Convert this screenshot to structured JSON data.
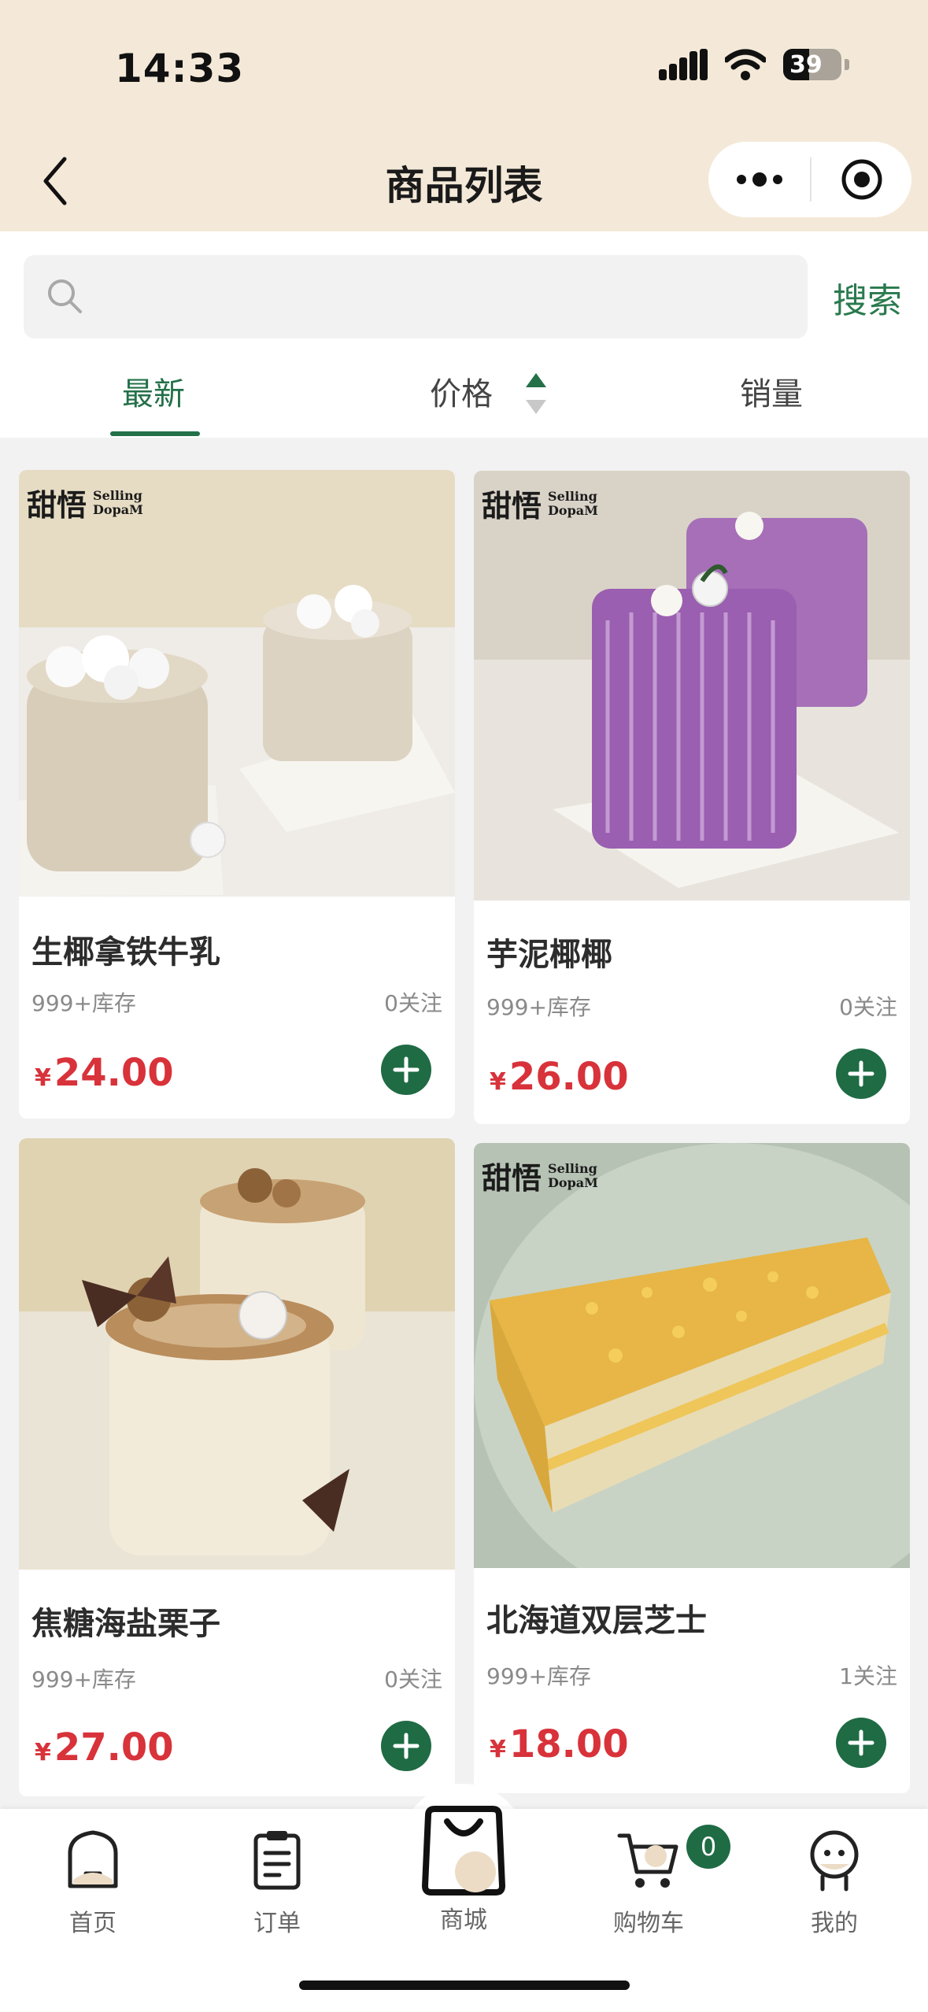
{
  "status_bar": {
    "time": "14:33",
    "battery": "39"
  },
  "nav": {
    "title": "商品列表"
  },
  "search": {
    "placeholder": "",
    "button": "搜索"
  },
  "sort_tabs": [
    {
      "label": "最新",
      "active": true
    },
    {
      "label": "价格",
      "active": false
    },
    {
      "label": "销量",
      "active": false
    }
  ],
  "products": [
    {
      "name": "生椰拿铁牛乳",
      "stock": "999+库存",
      "follow": "0关注",
      "currency": "¥",
      "price": "24.00"
    },
    {
      "name": "芋泥椰椰",
      "stock": "999+库存",
      "follow": "0关注",
      "currency": "¥",
      "price": "26.00"
    },
    {
      "name": "焦糖海盐栗子",
      "stock": "999+库存",
      "follow": "0关注",
      "currency": "¥",
      "price": "27.00"
    },
    {
      "name": "北海道双层芝士",
      "stock": "999+库存",
      "follow": "1关注",
      "currency": "¥",
      "price": "18.00"
    }
  ],
  "brand": {
    "cn": "甜悟",
    "en1": "Selling",
    "en2": "DopaM"
  },
  "tabbar": [
    {
      "label": "首页",
      "icon": "home-icon"
    },
    {
      "label": "订单",
      "icon": "clipboard-icon"
    },
    {
      "label": "商城",
      "icon": "shopping-bag-icon"
    },
    {
      "label": "购物车",
      "icon": "cart-icon"
    },
    {
      "label": "我的",
      "icon": "user-icon"
    }
  ],
  "cart_count": "0",
  "colors": {
    "accent": "#1f6b44",
    "price": "#d8323a",
    "header_bg": "#f4e9d8"
  }
}
